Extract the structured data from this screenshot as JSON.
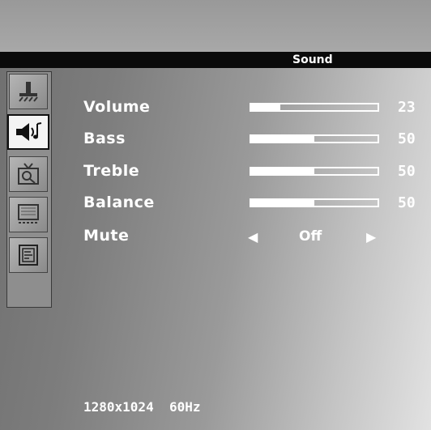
{
  "menu_title": "Sound",
  "items": [
    {
      "label": "Volume",
      "value": "23",
      "level": 0.23
    },
    {
      "label": "Bass",
      "value": "50",
      "level": 0.5
    },
    {
      "label": "Treble",
      "value": "50",
      "level": 0.5
    },
    {
      "label": "Balance",
      "value": "50",
      "level": 0.5
    }
  ],
  "mute": {
    "label": "Mute",
    "value": "Off"
  },
  "status": "1280x1024  60Hz",
  "tabs": [
    "brightness-icon",
    "sound-icon",
    "tv-icon",
    "screen-icon",
    "info-icon"
  ]
}
